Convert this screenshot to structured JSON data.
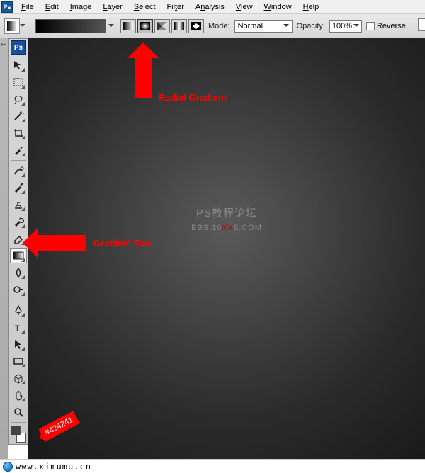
{
  "menu": {
    "items": [
      "File",
      "Edit",
      "Image",
      "Layer",
      "Select",
      "Filter",
      "Analysis",
      "View",
      "Window",
      "Help"
    ]
  },
  "options": {
    "mode_label": "Mode:",
    "mode_value": "Normal",
    "opacity_label": "Opacity:",
    "opacity_value": "100%",
    "reverse_label": "Reverse",
    "gradient_types": [
      "Linear",
      "Radial",
      "Angle",
      "Reflected",
      "Diamond"
    ],
    "selected_gradient_type": 1
  },
  "tools": {
    "ps_label": "Ps",
    "items": [
      {
        "name": "move-tool",
        "icon": "move"
      },
      {
        "name": "marquee-tool",
        "icon": "marquee"
      },
      {
        "name": "lasso-tool",
        "icon": "lasso"
      },
      {
        "name": "magic-wand-tool",
        "icon": "wand"
      },
      {
        "name": "crop-tool",
        "icon": "crop"
      },
      {
        "name": "eyedropper-tool",
        "icon": "eyedropper"
      },
      {
        "name": "healing-brush-tool",
        "icon": "heal"
      },
      {
        "name": "brush-tool",
        "icon": "brush"
      },
      {
        "name": "clone-stamp-tool",
        "icon": "stamp"
      },
      {
        "name": "history-brush-tool",
        "icon": "histbrush"
      },
      {
        "name": "eraser-tool",
        "icon": "eraser"
      },
      {
        "name": "gradient-tool",
        "icon": "gradient",
        "selected": true
      },
      {
        "name": "blur-tool",
        "icon": "blur"
      },
      {
        "name": "dodge-tool",
        "icon": "dodge"
      },
      {
        "name": "pen-tool",
        "icon": "pen"
      },
      {
        "name": "type-tool",
        "icon": "type"
      },
      {
        "name": "path-selection-tool",
        "icon": "pathsel"
      },
      {
        "name": "shape-tool",
        "icon": "shape"
      },
      {
        "name": "3d-tool",
        "icon": "threed"
      },
      {
        "name": "hand-tool",
        "icon": "hand"
      },
      {
        "name": "zoom-tool",
        "icon": "zoom"
      }
    ],
    "foreground_color": "#424241",
    "background_color": "#ffffff"
  },
  "annotations": {
    "radial": "Radial Gradient",
    "gradient_tool": "Gradient Tool",
    "color_code": "#424241"
  },
  "watermark": {
    "line1": "PS教程论坛",
    "line2_a": "BBS.16",
    "line2_b": "XX",
    "line2_c": "8.COM"
  },
  "footer": {
    "url": "www.ximumu.cn"
  }
}
